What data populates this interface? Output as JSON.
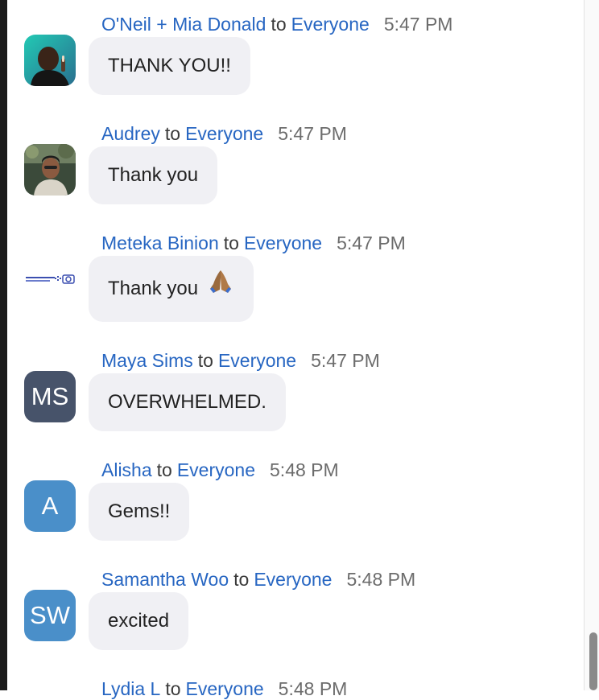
{
  "messages": [
    {
      "sender": "O'Neil + Mia Donald",
      "to": "to",
      "recipient": "Everyone",
      "time": "5:47 PM",
      "text": "THANK YOU!!"
    },
    {
      "sender": "Audrey",
      "to": "to",
      "recipient": "Everyone",
      "time": "5:47 PM",
      "text": "Thank you"
    },
    {
      "sender": "Meteka Binion",
      "to": "to",
      "recipient": "Everyone",
      "time": "5:47 PM",
      "text": "Thank you"
    },
    {
      "sender": "Maya Sims",
      "to": "to",
      "recipient": "Everyone",
      "time": "5:47 PM",
      "text": "OVERWHELMED.",
      "initials": "MS",
      "avatar_color": "#47536a"
    },
    {
      "sender": "Alisha",
      "to": "to",
      "recipient": "Everyone",
      "time": "5:48 PM",
      "text": "Gems!!",
      "initials": "A",
      "avatar_color": "#4a8fc9"
    },
    {
      "sender": "Samantha Woo",
      "to": "to",
      "recipient": "Everyone",
      "time": "5:48 PM",
      "text": "excited",
      "initials": "SW",
      "avatar_color": "#4a8fc9"
    },
    {
      "sender": "Lydia L",
      "to": "to",
      "recipient": "Everyone",
      "time": "5:48 PM"
    }
  ],
  "colors": {
    "link": "#2766c2",
    "bubble": "#f0f0f4",
    "time": "#6c6c6c"
  }
}
